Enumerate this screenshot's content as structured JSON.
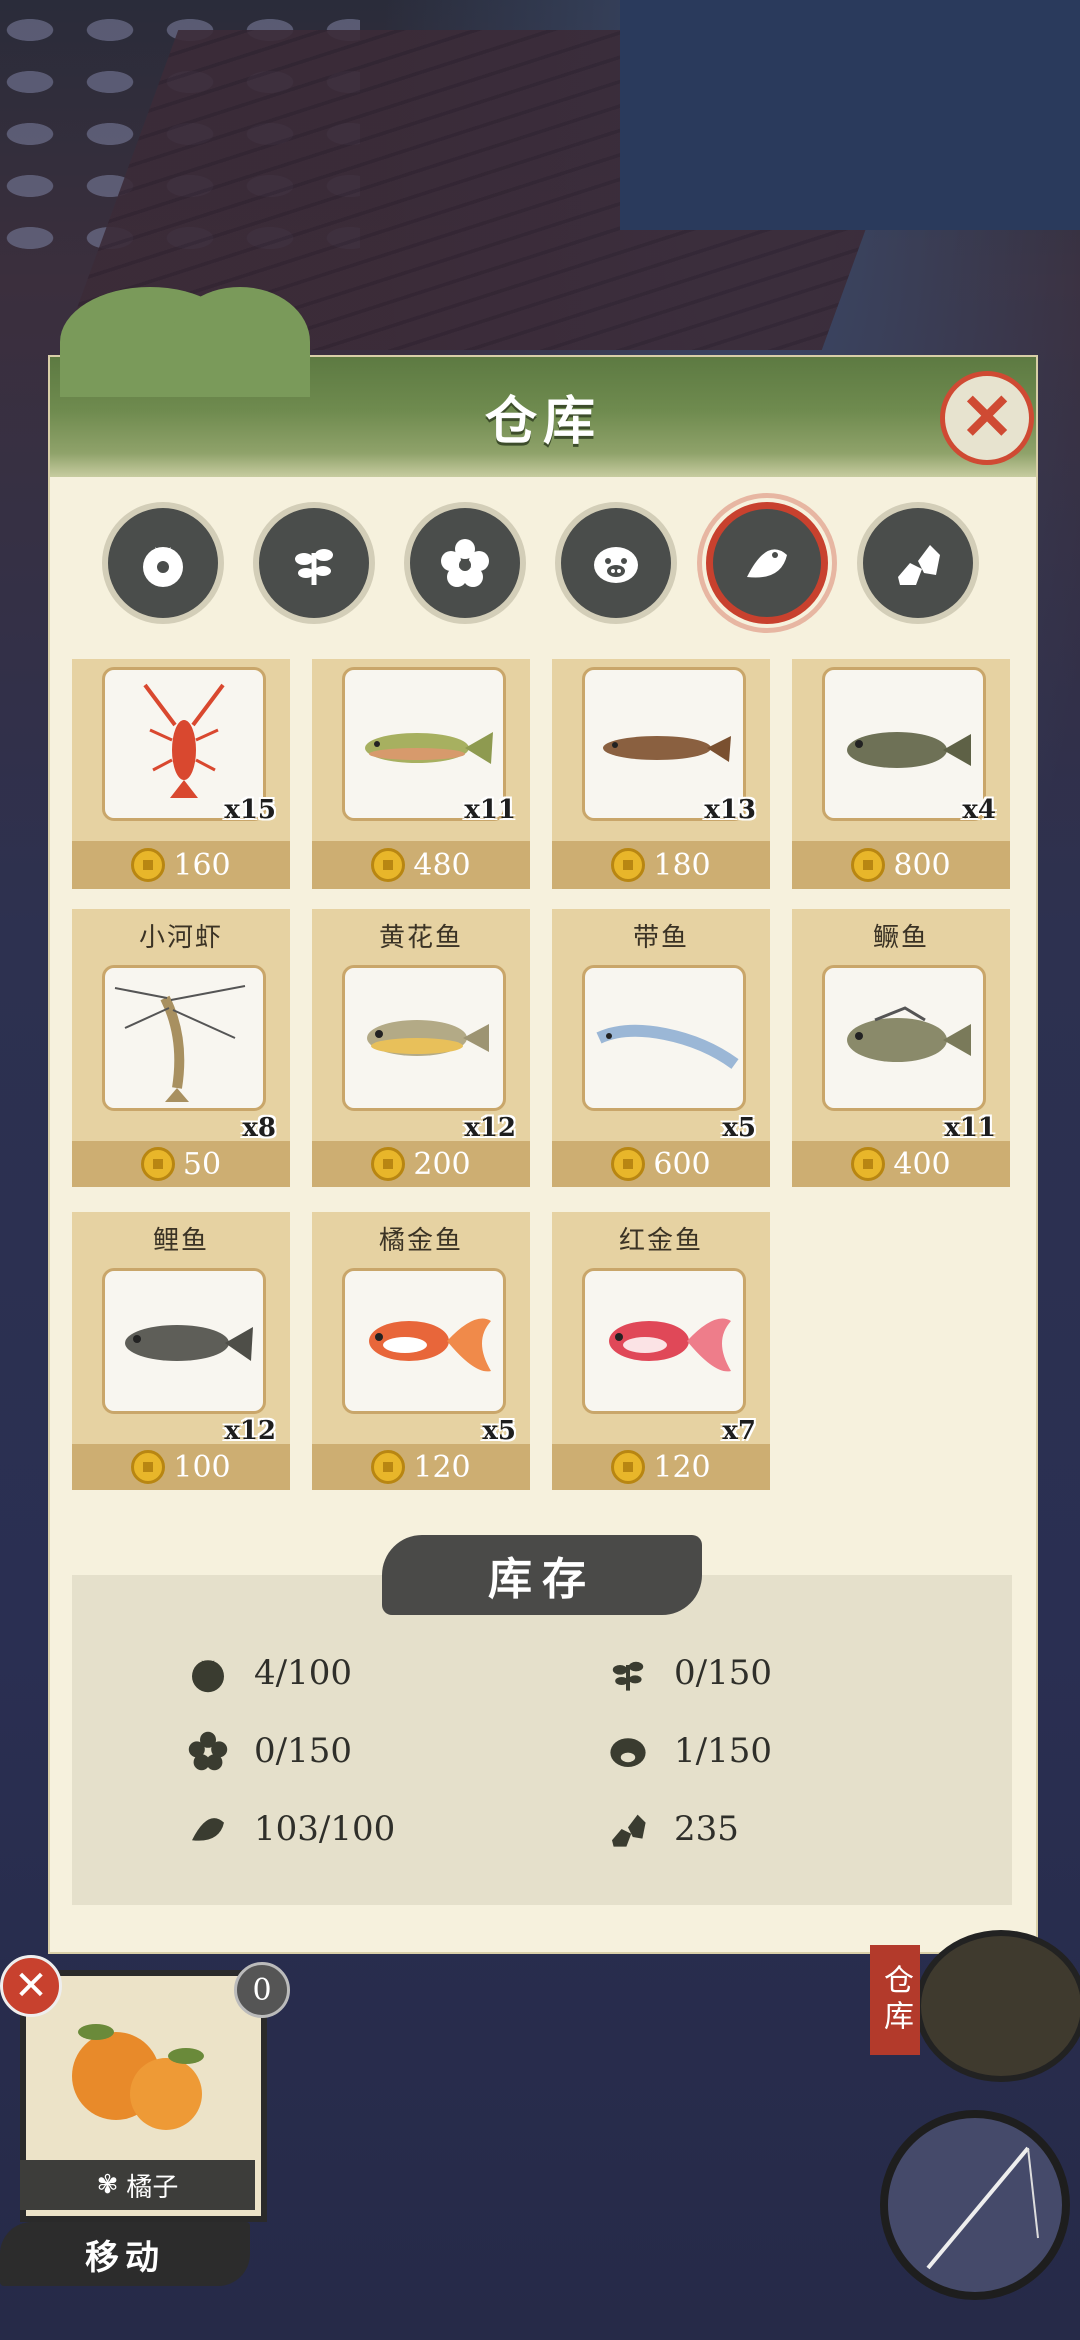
{
  "panel": {
    "title": "仓库",
    "close_label": "✕"
  },
  "tabs": [
    {
      "icon": "tomato-icon",
      "active": false
    },
    {
      "icon": "herb-icon",
      "active": false
    },
    {
      "icon": "flower-icon",
      "active": false
    },
    {
      "icon": "pig-icon",
      "active": false
    },
    {
      "icon": "fish-icon",
      "active": true
    },
    {
      "icon": "ore-icon",
      "active": false
    }
  ],
  "items": [
    {
      "name": "",
      "icon": "crayfish-icon",
      "qty": "x15",
      "price": "160"
    },
    {
      "name": "",
      "icon": "trout-icon",
      "qty": "x11",
      "price": "480"
    },
    {
      "name": "",
      "icon": "loach-icon",
      "qty": "x13",
      "price": "180"
    },
    {
      "name": "",
      "icon": "goby-icon",
      "qty": "x4",
      "price": "800"
    },
    {
      "name": "小河虾",
      "icon": "shrimp-icon",
      "qty": "x8",
      "price": "50"
    },
    {
      "name": "黄花鱼",
      "icon": "croaker-icon",
      "qty": "x12",
      "price": "200"
    },
    {
      "name": "带鱼",
      "icon": "hairtail-icon",
      "qty": "x5",
      "price": "600"
    },
    {
      "name": "鳜鱼",
      "icon": "mandarin-fish-icon",
      "qty": "x11",
      "price": "400"
    },
    {
      "name": "鲤鱼",
      "icon": "carp-icon",
      "qty": "x12",
      "price": "100"
    },
    {
      "name": "橘金鱼",
      "icon": "orange-goldfish-icon",
      "qty": "x5",
      "price": "120"
    },
    {
      "name": "红金鱼",
      "icon": "red-goldfish-icon",
      "qty": "x7",
      "price": "120"
    }
  ],
  "stock": {
    "title": "库存",
    "entries": [
      {
        "icon": "tomato-icon",
        "value": "4/100"
      },
      {
        "icon": "herb-icon",
        "value": "0/150"
      },
      {
        "icon": "flower-icon",
        "value": "0/150"
      },
      {
        "icon": "pig-icon",
        "value": "1/150"
      },
      {
        "icon": "fish-icon",
        "value": "103/100"
      },
      {
        "icon": "ore-icon",
        "value": "235"
      }
    ]
  },
  "hud": {
    "selected_item_label": "橘子",
    "count_badge": "0",
    "move_label": "移动",
    "warehouse_label": "仓库"
  },
  "colors": {
    "accent_red": "#c8412e",
    "panel_bg": "#f6f1dd",
    "header_green": "#6f8b4f",
    "card_bg": "#e6d2a2",
    "coin_gold": "#e8b62a"
  }
}
